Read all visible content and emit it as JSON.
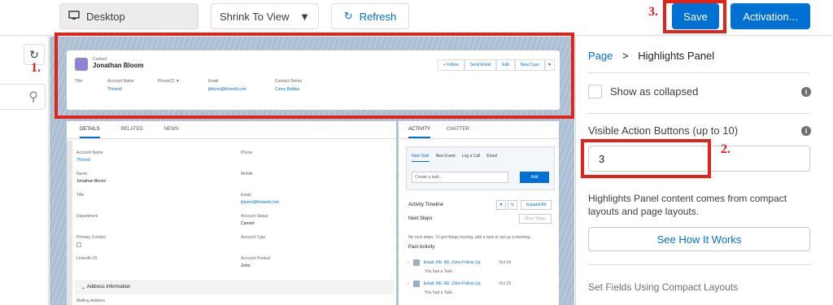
{
  "toolbar": {
    "device_label": "Desktop",
    "view_label": "Shrink To View",
    "refresh_label": "Refresh",
    "save_label": "Save",
    "activation_label": "Activation..."
  },
  "highlights": {
    "object_type": "Contact",
    "name": "Jonathan Bloom",
    "actions": [
      "+ Follow",
      "Send Email",
      "Edit",
      "New Case"
    ],
    "fields": [
      {
        "key": "Title",
        "value": ""
      },
      {
        "key": "Account Name",
        "value": "Thrivedi"
      },
      {
        "key": "Phone(2) ▼",
        "value": ""
      },
      {
        "key": "Email",
        "value": "jbloom@thrivedi.com"
      },
      {
        "key": "Contact Owner",
        "value": "Corey Batbka"
      }
    ]
  },
  "details": {
    "tabs": [
      "DETAILS",
      "RELATED",
      "NEWS"
    ],
    "left_fields": [
      {
        "key": "Account Name",
        "value": "Thrived"
      },
      {
        "key": "Name",
        "value": "Jonathan Bloom"
      },
      {
        "key": "Title",
        "value": ""
      },
      {
        "key": "Department",
        "value": ""
      },
      {
        "key": "Primary Contact",
        "value": ""
      },
      {
        "key": "LinkedIn ID",
        "value": ""
      }
    ],
    "right_fields": [
      {
        "key": "Phone",
        "value": ""
      },
      {
        "key": "Mobile",
        "value": ""
      },
      {
        "key": "Email",
        "value": "jbloom@thrivedi.com"
      },
      {
        "key": "Account Status",
        "value": "Current"
      },
      {
        "key": "Account Type",
        "value": ""
      },
      {
        "key": "Account Product",
        "value": "Zoho"
      }
    ],
    "section": "Address Information",
    "mailing_label": "Mailing Address"
  },
  "activity": {
    "tabs": [
      "ACTIVITY",
      "CHATTER"
    ],
    "subtabs": [
      "New Task",
      "New Event",
      "Log a Call",
      "Email"
    ],
    "task_placeholder": "Create a task...",
    "add_label": "Add",
    "timeline_label": "Activity Timeline",
    "expand_label": "Expand All",
    "next_steps": "Next Steps",
    "more_steps": "More Steps",
    "no_steps": "No next steps. To get things moving, add a task or set up a meeting.",
    "past_activity": "Past Activity",
    "emails": [
      {
        "subject": "Email: RE: RE: Zoho Follow Up",
        "date": "Oct 24",
        "sub": "You had a Task"
      },
      {
        "subject": "Email: RE: RE: Zoho Follow Up",
        "date": "Oct 23",
        "sub": "You had a Task"
      }
    ]
  },
  "annotations": {
    "one": "1.",
    "two": "2.",
    "three": "3."
  },
  "panel": {
    "crumb_page": "Page",
    "crumb_sep": ">",
    "crumb_current": "Highlights Panel",
    "show_collapsed_label": "Show as collapsed",
    "vab_label": "Visible Action Buttons (up to 10)",
    "vab_value": "3",
    "help_text": "Highlights Panel content comes from compact layouts and page layouts.",
    "how_label": "See How It Works",
    "set_fields_label": "Set Fields Using Compact Layouts"
  }
}
